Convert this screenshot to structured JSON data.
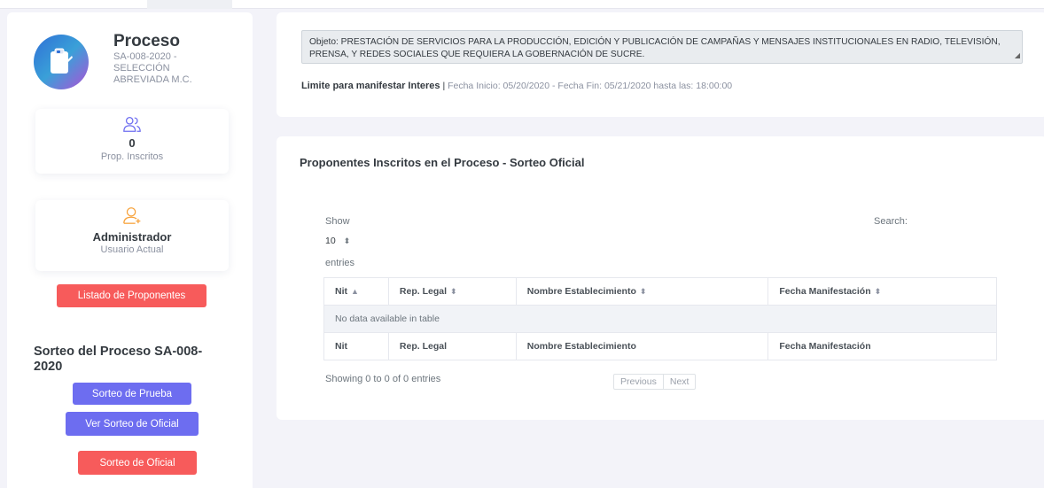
{
  "sidebar": {
    "process": {
      "title": "Proceso",
      "code": "SA-008-2020 -",
      "type": "SELECCIÓN ABREVIADA M.C."
    },
    "inscritos_card": {
      "count": "0",
      "label": "Prop. Inscritos",
      "icon": "users-icon"
    },
    "admin_card": {
      "role": "Administrador",
      "label": "Usuario Actual",
      "icon": "user-add-icon"
    },
    "listado_button": "Listado de Proponentes",
    "sorteo_title": "Sorteo del Proceso SA-008-2020",
    "prueba_button": "Sorteo de Prueba",
    "ver_oficial_button": "Ver Sorteo de Oficial",
    "oficial_button": "Sorteo de Oficial"
  },
  "objeto": {
    "text": "Objeto: PRESTACIÓN DE SERVICIOS PARA LA PRODUCCIÓN, EDICIÓN Y PUBLICACIÓN DE CAMPAÑAS Y MENSAJES INSTITUCIONALES EN RADIO, TELEVISIÓN, PRENSA, Y REDES SOCIALES QUE REQUIERA LA GOBERNACIÓN DE SUCRE."
  },
  "limite": {
    "label": "Limite para manifestar Interes",
    "separator": "|",
    "dates": "Fecha Inicio: 05/20/2020 - Fecha Fin: 05/21/2020 hasta las: 18:00:00"
  },
  "table_panel": {
    "title": "Proponentes Inscritos en el Proceso - Sorteo Oficial",
    "show_label": "Show",
    "page_size": "10",
    "entries_label": "entries",
    "search_label": "Search:",
    "columns": [
      "Nit",
      "Rep. Legal",
      "Nombre Establecimiento",
      "Fecha Manifestación"
    ],
    "empty_message": "No data available in table",
    "info": "Showing 0 to 0 of 0 entries",
    "previous": "Previous",
    "next": "Next"
  },
  "colors": {
    "accent_red": "#f75b5b",
    "accent_purple": "#6d6df0",
    "icon_purple": "#6d6df0",
    "icon_orange": "#f7a23b"
  }
}
